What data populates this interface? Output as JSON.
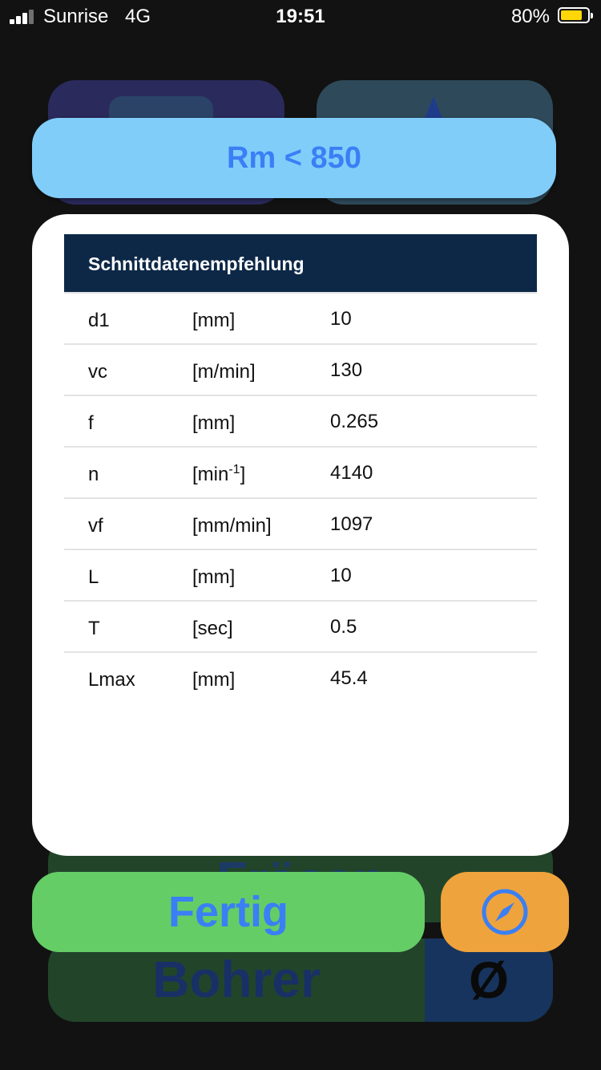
{
  "status_bar": {
    "carrier": "Sunrise",
    "network": "4G",
    "time": "19:51",
    "battery_percent": "80%",
    "battery_level": 0.8,
    "battery_color": "#ffd60a"
  },
  "background": {
    "bottom_tile_label": "Bohrer",
    "bottom_tile_symbol": "Ø"
  },
  "header": {
    "title": "Rm < 850"
  },
  "table": {
    "title": "Schnittdatenempfehlung",
    "rows": [
      {
        "name": "d1",
        "unit": "[mm]",
        "value": "10"
      },
      {
        "name": "vc",
        "unit": "[m/min]",
        "value": "130"
      },
      {
        "name": "f",
        "unit": "[mm]",
        "value": "0.265"
      },
      {
        "name": "n",
        "unit_base": "[min",
        "unit_sup": "-1",
        "unit_end": "]",
        "value": "4140"
      },
      {
        "name": "vf",
        "unit": "[mm/min]",
        "value": "1097"
      },
      {
        "name": "L",
        "unit": "[mm]",
        "value": "10"
      },
      {
        "name": "T",
        "unit": "[sec]",
        "value": "0.5"
      },
      {
        "name": "Lmax",
        "unit": "[mm]",
        "value": "45.4"
      }
    ]
  },
  "actions": {
    "done_label": "Fertig",
    "compass_icon": "compass-icon"
  },
  "colors": {
    "header_bg": "#81cdfa",
    "accent_text": "#3a7ff5",
    "done_bg": "#65cd66",
    "compass_bg": "#efa33c",
    "table_header_bg": "#0d2847"
  }
}
